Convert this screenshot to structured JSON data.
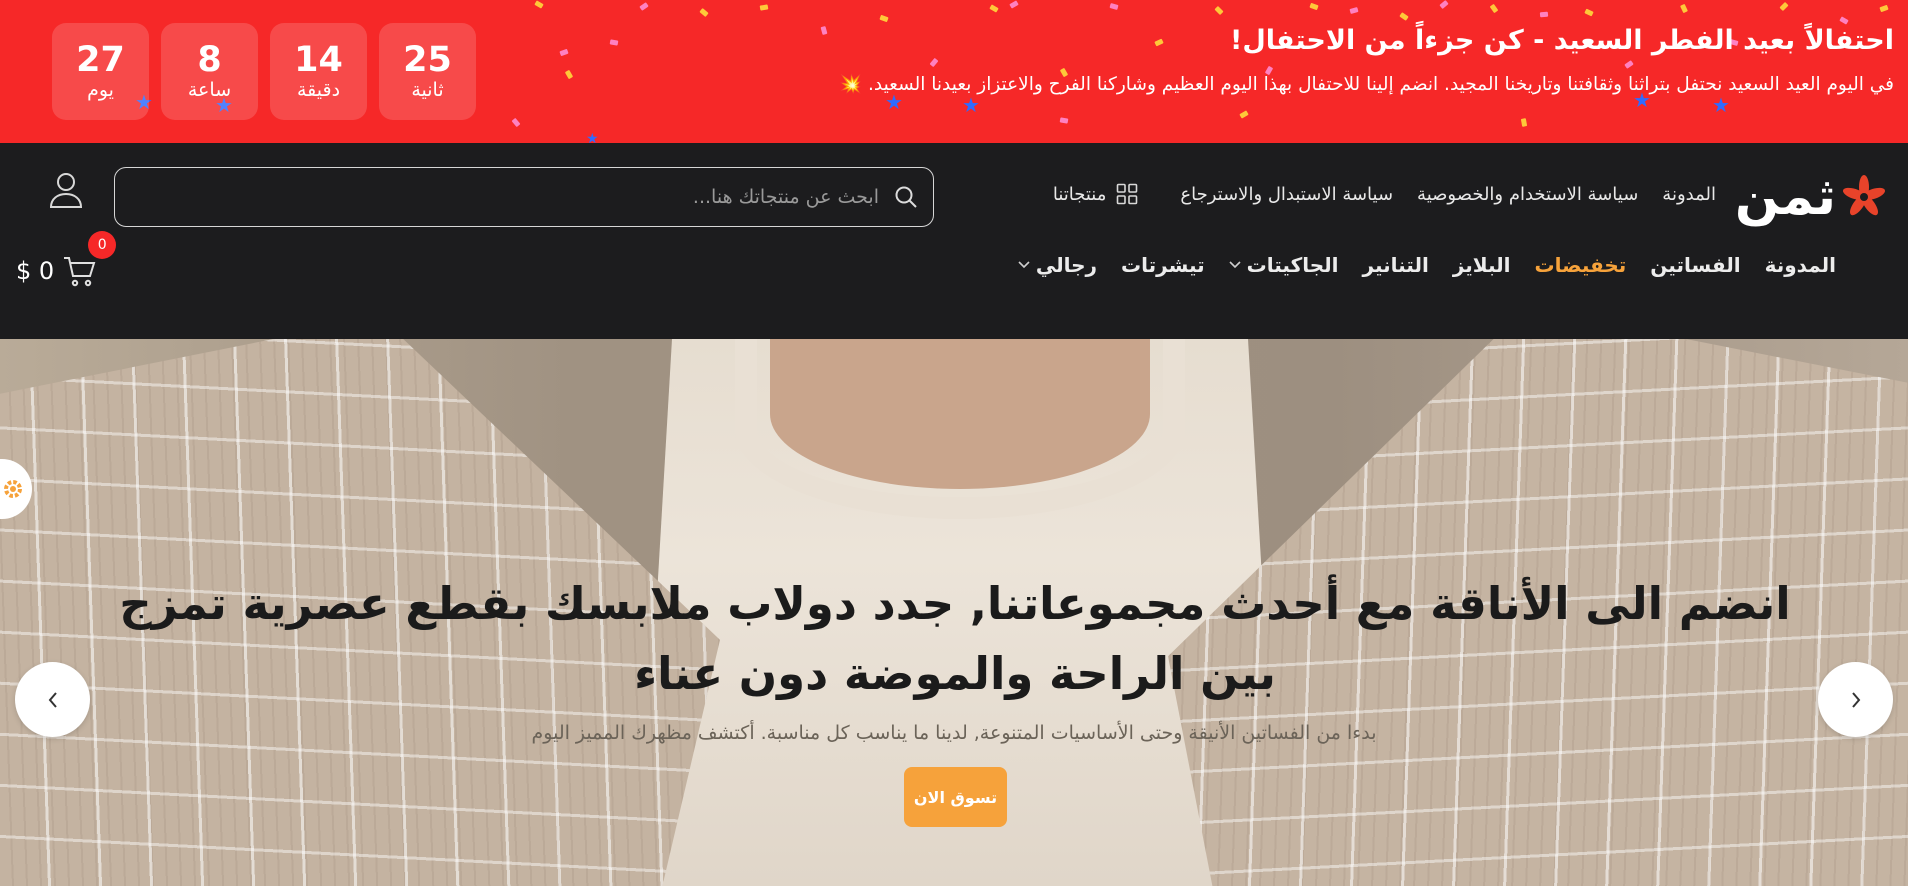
{
  "promo": {
    "title": "احتفالاً بعيد الفطر السعيد - كن جزءاً من الاحتفال!",
    "text": "في اليوم العيد السعيد نحتفل بتراثنا وثقافتنا وتاريخنا المجيد. انضم إلينا للاحتفال بهذا اليوم العظيم وشاركنا الفرح والاعتزاز بعيدنا السعيد. 💥",
    "countdown": {
      "days": {
        "value": "27",
        "label": "يوم"
      },
      "hours": {
        "value": "8",
        "label": "ساعة"
      },
      "minutes": {
        "value": "14",
        "label": "دقيقة"
      },
      "seconds": {
        "value": "25",
        "label": "ثانية"
      }
    },
    "background": "#f62828"
  },
  "header": {
    "logo_text": "ثمن",
    "top_links": [
      "المدونة",
      "سياسة الاستخدام والخصوصية",
      "سياسة الاستبدال والاسترجاع"
    ],
    "products_link": "منتجاتنا",
    "search_placeholder": "ابحث عن منتجاتك هنا...",
    "nav": [
      {
        "label": "المدونة"
      },
      {
        "label": "الفساتين"
      },
      {
        "label": "تخفيضات"
      },
      {
        "label": "البلايز"
      },
      {
        "label": "التنانير"
      },
      {
        "label": "الجاكيتات"
      },
      {
        "label": "تيشرتات"
      },
      {
        "label": "رجالي"
      }
    ],
    "cart": {
      "count": "0",
      "total": "$ 0"
    },
    "accent": "#f6a23b"
  },
  "hero": {
    "title_line1": "انضم الى الأناقة مع أحدث مجموعاتنا, جدد دولاب ملابسك بقطع عصرية تمزج",
    "title_line2": "بين الراحة والموضة دون عناء",
    "subtitle": "بدءا من الفساتين الأنيقة وحتى الأساسيات المتنوعة, لدينا ما يناسب كل مناسبة. أكتشف مظهرك المميز اليوم",
    "cta": "تسوق الان"
  }
}
